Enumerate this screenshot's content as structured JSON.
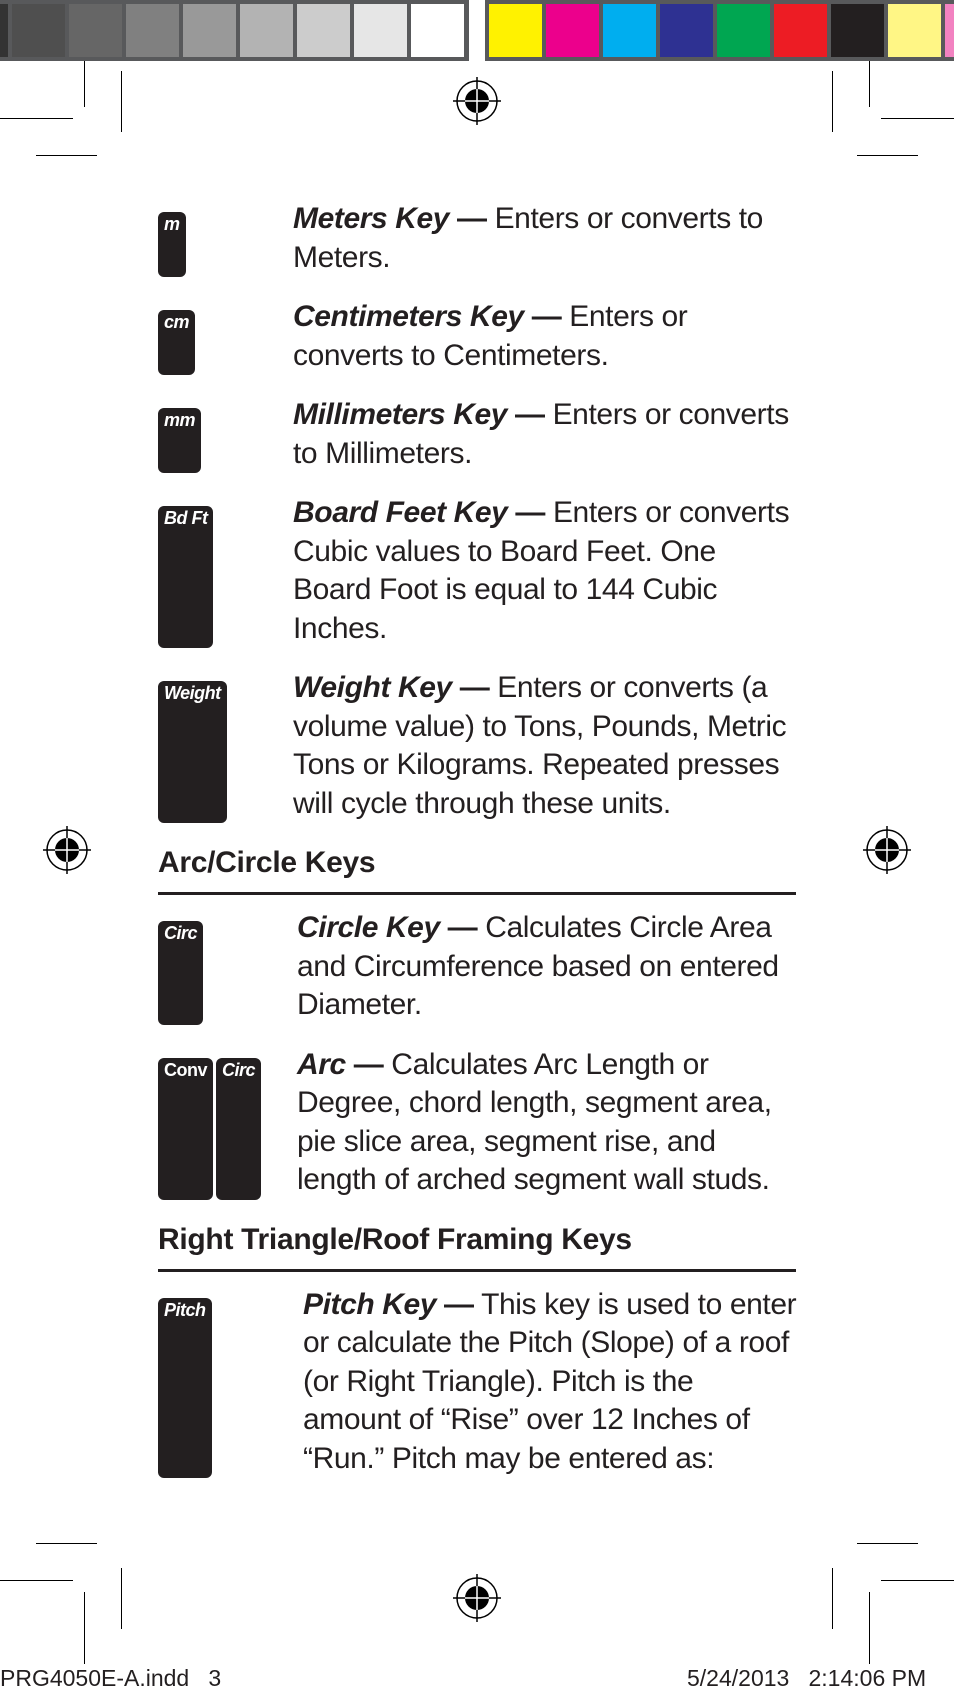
{
  "color_bar": {
    "grayscale": [
      "#333333",
      "#4f4f4f",
      "#666666",
      "#808080",
      "#999999",
      "#b3b3b3",
      "#cccccc",
      "#e6e6e6",
      "#ffffff"
    ],
    "process": [
      "#fff200",
      "#ec008c",
      "#00aeef",
      "#2e3192",
      "#00a651",
      "#ed1c24",
      "#231f20",
      "#fff685",
      "#f282c1"
    ]
  },
  "sections": [
    {
      "title": "",
      "entries": [
        {
          "keys": [
            "m"
          ],
          "term": "Meters Key",
          "dash": " —",
          "text": " Enters or converts to Meters."
        },
        {
          "keys": [
            "cm"
          ],
          "term": "Centimeters Key",
          "dash": " —",
          "text": " Enters or converts to Centimeters."
        },
        {
          "keys": [
            "mm"
          ],
          "term": "Millimeters Key",
          "dash": " —",
          "text": " Enters or converts to Millimeters."
        },
        {
          "keys": [
            "Bd Ft"
          ],
          "term": "Board Feet Key",
          "dash": " —",
          "text": " Enters or converts Cubic values to Board Feet. One Board Foot is equal to 144 Cubic Inches."
        },
        {
          "keys": [
            "Weight"
          ],
          "term": "Weight Key",
          "dash": " —",
          "text": " Enters or converts (a volume value) to Tons, Pounds, Metric Tons or Kilograms. Repeated presses will cycle through these units."
        }
      ]
    },
    {
      "title": "Arc/Circle Keys",
      "entries": [
        {
          "keys": [
            "Circ"
          ],
          "term": "Circle Key",
          "dash": " —",
          "text": " Calculates Circle Area and Circumference based on entered Diameter."
        },
        {
          "keys": [
            "Conv",
            "Circ"
          ],
          "term": "Arc",
          "dash": " —",
          "text": " Calculates Arc Length or Degree, chord length, segment area, pie slice area, segment rise, and length of arched segment wall studs."
        }
      ]
    },
    {
      "title": "Right Triangle/Roof Framing Keys",
      "entries": [
        {
          "keys": [
            "Pitch"
          ],
          "term": "Pitch Key",
          "dash": " —",
          "text": " This key is used to enter or calculate the Pitch (Slope) of a roof (or Right Triangle). Pitch is the amount of “Rise” over 12 Inches of “Run.” Pitch may be entered as:"
        }
      ]
    }
  ],
  "footer": {
    "file": "PRG4050E-A.indd   3",
    "datetime": "5/24/2013   2:14:06 PM"
  }
}
